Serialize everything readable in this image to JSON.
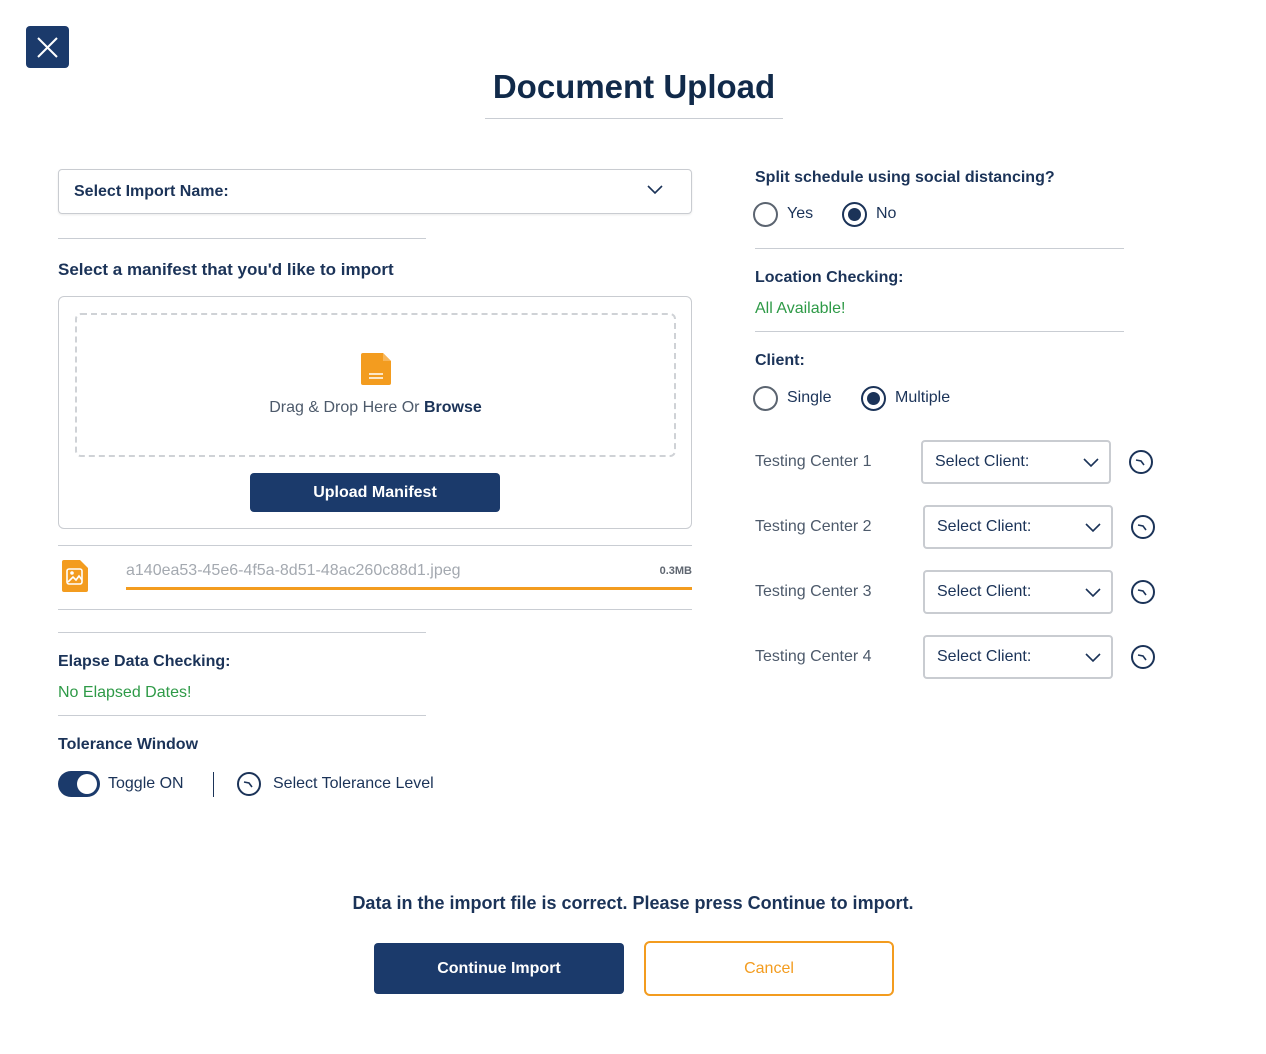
{
  "page": {
    "title": "Document Upload",
    "close_icon": "close-icon"
  },
  "import_select": {
    "label": "Select Import Name:",
    "icon": "chevron-down-icon"
  },
  "manifest": {
    "heading": "Select a manifest that you'd like to import",
    "drop_text": "Drag & Drop Here Or ",
    "browse_label": "Browse",
    "file_icon": "file-icon",
    "upload_button": "Upload Manifest"
  },
  "uploaded_file": {
    "icon": "image-file-icon",
    "name": "a140ea53-45e6-4f5a-8d51-48ac260c88d1.jpeg",
    "size": "0.3MB",
    "progress": 1.0
  },
  "elapse_check": {
    "label": "Elapse Data Checking:",
    "status": "No Elapsed Dates!"
  },
  "tolerance": {
    "heading": "Tolerance Window",
    "toggle_label": "Toggle ON",
    "toggle_on": true,
    "level_label": "Select Tolerance Level",
    "level_icon": "clock-icon"
  },
  "split_schedule": {
    "question": "Split schedule using social distancing?",
    "options": [
      "Yes",
      "No"
    ],
    "selected": "No"
  },
  "location_check": {
    "label": "Location Checking:",
    "status": "All Available!"
  },
  "client": {
    "label": "Client:",
    "options": [
      "Single",
      "Multiple"
    ],
    "selected": "Multiple"
  },
  "testing_centers": [
    {
      "label": "Testing Center 1",
      "select": "Select Client:"
    },
    {
      "label": "Testing Center 2",
      "select": "Select Client:"
    },
    {
      "label": "Testing Center 3",
      "select": "Select Client:"
    },
    {
      "label": "Testing Center 4",
      "select": "Select Client:"
    }
  ],
  "footer": {
    "message": "Data in the import file is correct. Please press Continue to import.",
    "continue_button": "Continue Import",
    "cancel_button": "Cancel"
  },
  "colors": {
    "primary": "#1b3a6b",
    "accent": "#f39c1f",
    "success": "#2e9a47"
  }
}
